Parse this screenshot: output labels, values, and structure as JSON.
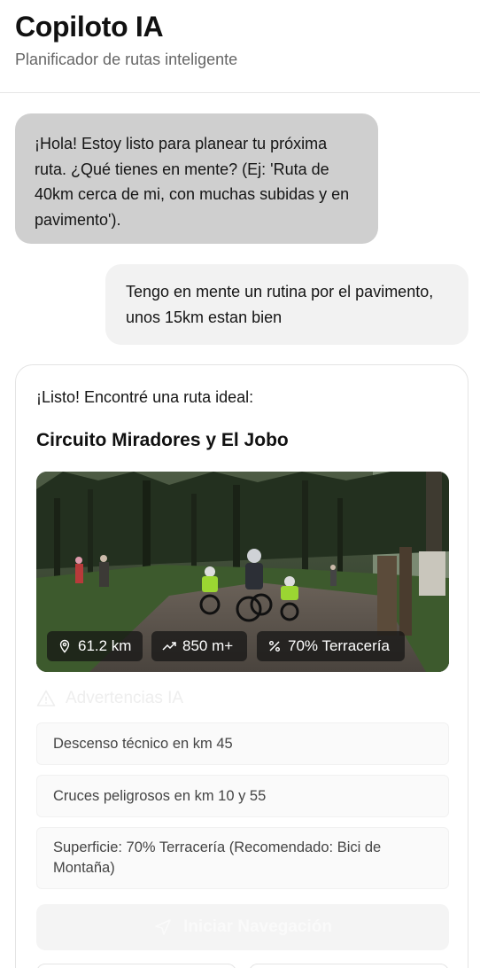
{
  "header": {
    "title": "Copiloto IA",
    "subtitle": "Planificador de rutas inteligente"
  },
  "messages": {
    "ai_greeting": "¡Hola! Estoy listo para planear tu próxima ruta. ¿Qué tienes en mente? (Ej: 'Ruta de 40km cerca de mi, con muchas subidas y en pavimento').",
    "user_request": "Tengo en mente un rutina por el pavimento, unos 15km estan bien"
  },
  "route_card": {
    "intro": "¡Listo! Encontré una ruta ideal:",
    "route_name": "Circuito Miradores y El Jobo",
    "stats": {
      "distance": "61.2 km",
      "elevation": "850 m+",
      "terrain": "70% Terracería"
    },
    "warnings_title": "Advertencias IA",
    "warnings": [
      "Descenso técnico en km 45",
      "Cruces peligrosos en km 10 y 55",
      "Superficie: 70% Terracería (Recomendado: Bici de Montaña)"
    ],
    "start_button": "Iniciar Navegación"
  },
  "icons": {
    "distance": "map-pin-icon",
    "elevation": "trending-up-icon",
    "terrain": "percent-icon",
    "warnings": "alert-triangle-icon",
    "navigation": "navigation-arrow-icon"
  },
  "colors": {
    "ai_bubble": "#cfcfcf",
    "user_bubble": "#f2f2f2",
    "stat_chip": "#141414"
  }
}
